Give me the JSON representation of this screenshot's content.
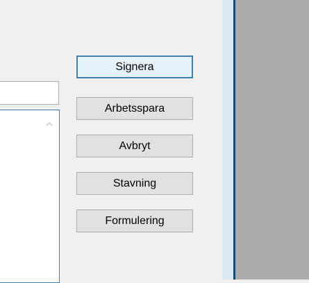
{
  "buttons": [
    {
      "label": "Signera"
    },
    {
      "label": "Arbetsspara"
    },
    {
      "label": "Avbryt"
    },
    {
      "label": "Stavning"
    },
    {
      "label": "Formulering"
    }
  ],
  "icons": {
    "scroll_up": "chevron-up-icon"
  },
  "colors": {
    "focus_border": "#3c7fb1",
    "button_face": "#e1e1e1",
    "window_background": "#f0f0f0",
    "backdrop": "#ababab"
  }
}
